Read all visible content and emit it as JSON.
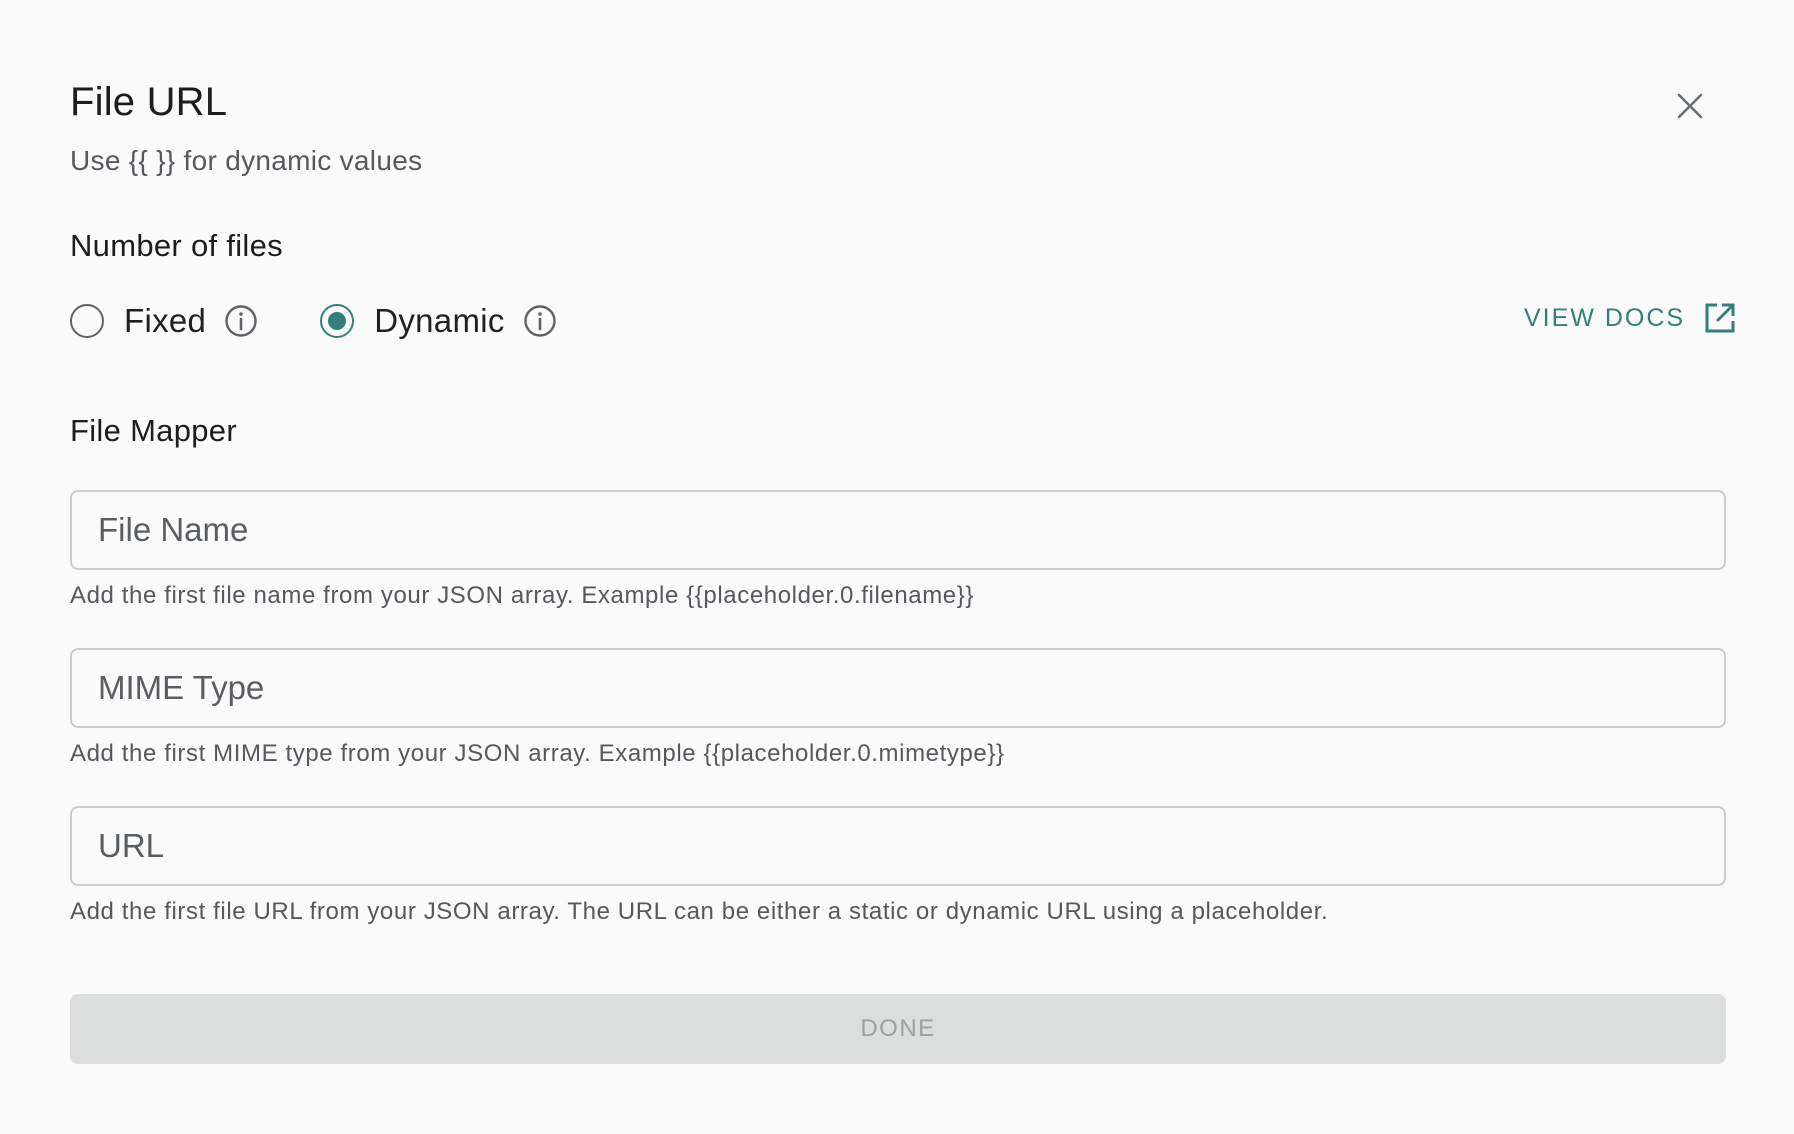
{
  "dialog": {
    "title": "File URL",
    "subtitle": "Use {{ }} for dynamic values",
    "close_icon": "close-icon"
  },
  "number_of_files": {
    "heading": "Number of files",
    "options": [
      {
        "label": "Fixed",
        "selected": false,
        "info_icon": "info-icon"
      },
      {
        "label": "Dynamic",
        "selected": true,
        "info_icon": "info-icon"
      }
    ],
    "view_docs_label": "VIEW DOCS",
    "view_docs_icon": "external-link-icon"
  },
  "file_mapper": {
    "heading": "File Mapper",
    "fields": [
      {
        "placeholder": "File Name",
        "value": "",
        "helper": "Add the first file name from your JSON array. Example {{placeholder.0.filename}}"
      },
      {
        "placeholder": "MIME Type",
        "value": "",
        "helper": "Add the first MIME type from your JSON array. Example {{placeholder.0.mimetype}}"
      },
      {
        "placeholder": "URL",
        "value": "",
        "helper": "Add the first file URL from your JSON array. The URL can be either a static or dynamic URL using a placeholder."
      }
    ]
  },
  "footer": {
    "done_label": "DONE"
  },
  "colors": {
    "accent": "#33807B",
    "background": "#FAFAFA",
    "disabled_button_bg": "#DCDDDD",
    "disabled_button_text": "#9EA0A3"
  }
}
